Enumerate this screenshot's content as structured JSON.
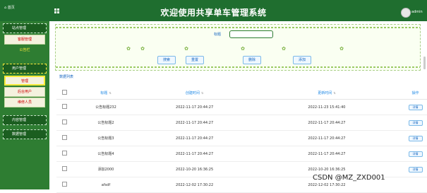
{
  "header": {
    "home_label": "首页",
    "title": "欢迎使用共享单车管理系统",
    "user": "admin"
  },
  "sidebar": {
    "groups": [
      {
        "label": "站点管理"
      },
      {
        "label": "用户管理"
      },
      {
        "label": "内容管理"
      },
      {
        "label": "数据管理"
      }
    ],
    "subitems": [
      {
        "label": "客服管理"
      },
      {
        "label": "公告栏"
      },
      {
        "label": "管理"
      },
      {
        "label": "后台用户"
      },
      {
        "label": "维修人员"
      }
    ]
  },
  "search": {
    "label": "标题",
    "value": "",
    "buttons": [
      "搜索",
      "重置",
      "删除",
      "添加"
    ]
  },
  "list": {
    "title": "数据列表",
    "columns": [
      "标题",
      "创建时间",
      "更新时间",
      "操作"
    ],
    "rows": [
      {
        "title": "公告标题232",
        "created": "2022-11-17 20:44:27",
        "updated": "2022-11-23 15:41:40",
        "op": "详情"
      },
      {
        "title": "公告标题2",
        "created": "2022-11-17 20:44:27",
        "updated": "2022-11-17 20:44:27",
        "op": "详情"
      },
      {
        "title": "公告标题3",
        "created": "2022-11-17 20:44:27",
        "updated": "2022-11-17 20:44:27",
        "op": "详情"
      },
      {
        "title": "公告标题4",
        "created": "2022-11-17 20:44:27",
        "updated": "2022-11-17 20:44:27",
        "op": "详情"
      },
      {
        "title": "添加2000",
        "created": "2022-10-20 16:36:25",
        "updated": "2022-10-20 16:36:25",
        "op": "详情"
      },
      {
        "title": "afsdf",
        "created": "2022-12-02 17:30:22",
        "updated": "2022-12-02 17:30:22",
        "op": ""
      }
    ]
  },
  "watermark": "CSDN @MZ_ZXD001",
  "colors": {
    "header": "#1f6e2f",
    "sidebar": "#2e7d32",
    "accent": "#1565c0"
  }
}
